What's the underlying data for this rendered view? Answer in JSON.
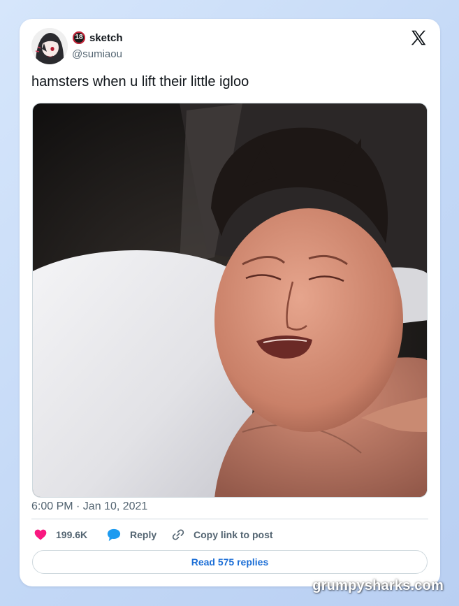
{
  "tweet": {
    "author": {
      "display_name": "sketch",
      "badge": "18",
      "handle": "@sumiaou",
      "avatar_icon": "anime-avatar"
    },
    "platform_logo": "x-logo",
    "text": "hamsters when u lift their little igloo",
    "media_description": "photo",
    "timestamp": "6:00 PM · Jan 10, 2021",
    "actions": {
      "like_count": "199.6K",
      "reply_label": "Reply",
      "copy_link_label": "Copy link to post"
    },
    "read_replies_label": "Read 575 replies"
  },
  "watermark": "grumpysharks.com",
  "colors": {
    "like": "#f91880",
    "reply": "#1d9bf0",
    "link": "#1d6fd6",
    "text_primary": "#0f1419",
    "text_secondary": "#536471",
    "background": "#c3d8f6"
  }
}
